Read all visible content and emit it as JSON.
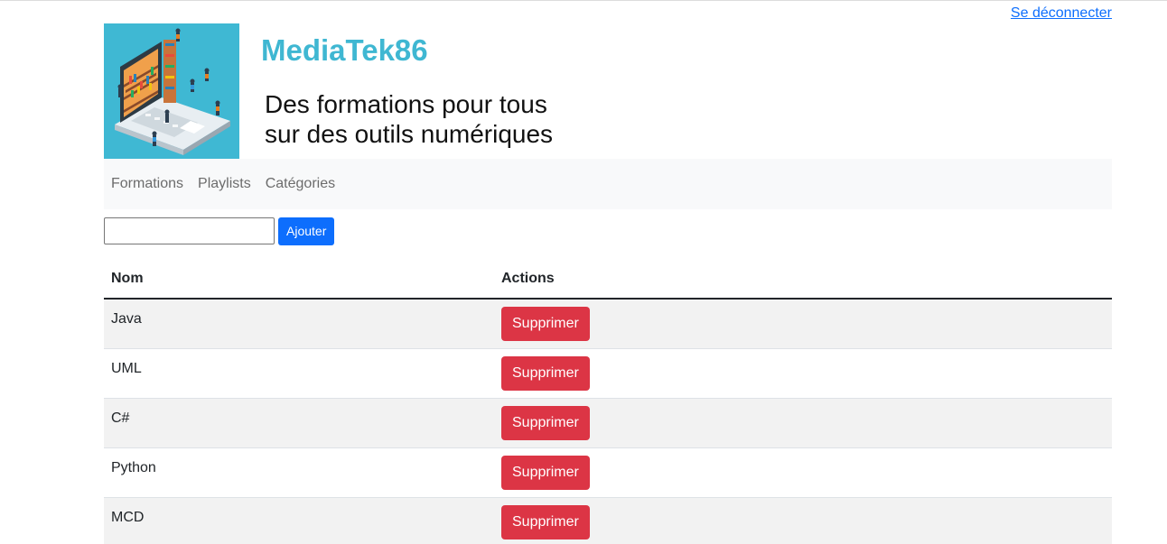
{
  "header": {
    "logout_label": "Se déconnecter",
    "title": "MediaTek86",
    "subtitle_line1": "Des formations pour tous",
    "subtitle_line2": "sur des outils numériques"
  },
  "nav": {
    "items": [
      {
        "label": "Formations"
      },
      {
        "label": "Playlists"
      },
      {
        "label": "Catégories"
      }
    ]
  },
  "form": {
    "input_value": "",
    "add_label": "Ajouter"
  },
  "table": {
    "headers": [
      "Nom",
      "Actions"
    ],
    "rows": [
      {
        "name": "Java",
        "action": "Supprimer"
      },
      {
        "name": "UML",
        "action": "Supprimer"
      },
      {
        "name": "C#",
        "action": "Supprimer"
      },
      {
        "name": "Python",
        "action": "Supprimer"
      },
      {
        "name": "MCD",
        "action": "Supprimer"
      }
    ]
  },
  "colors": {
    "accent": "#3fb7d2",
    "primary": "#0d6efd",
    "danger": "#dc3545",
    "logo_bg": "#3fb8d3"
  }
}
